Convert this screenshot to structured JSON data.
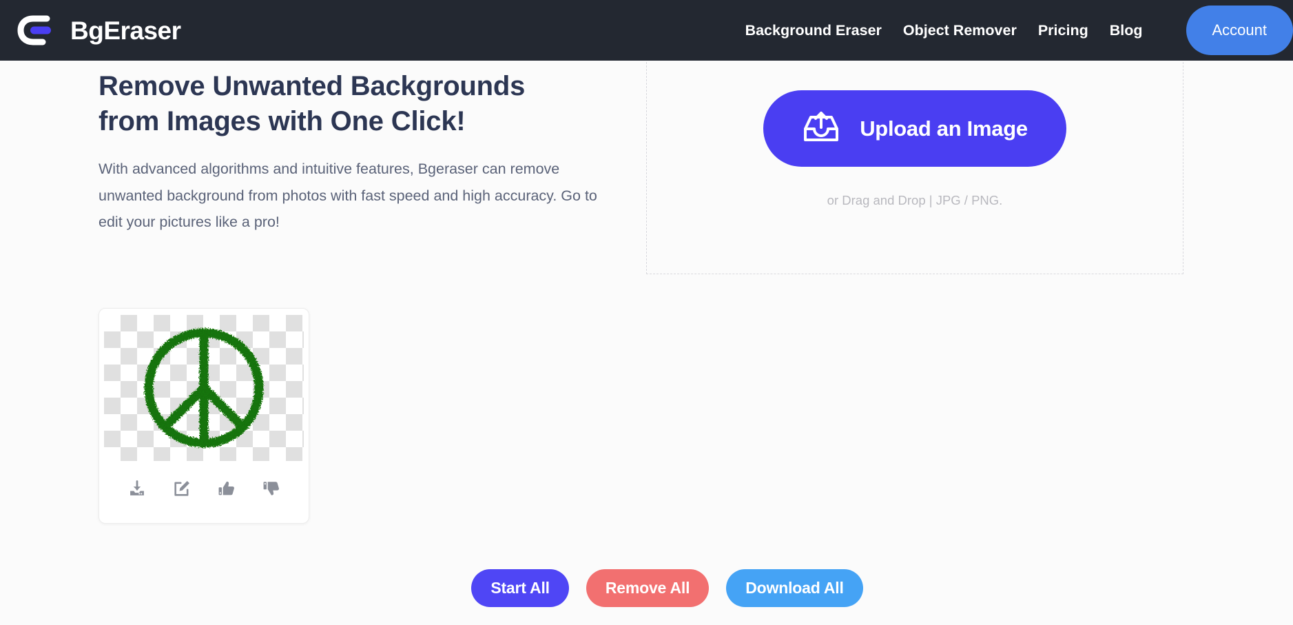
{
  "header": {
    "brand_name": "BgEraser",
    "brand_logo_icon": "bgeraser-logo-icon",
    "nav_links": [
      {
        "label": "Background Eraser",
        "name": "nav-background-eraser"
      },
      {
        "label": "Object Remover",
        "name": "nav-object-remover"
      },
      {
        "label": "Pricing",
        "name": "nav-pricing"
      },
      {
        "label": "Blog",
        "name": "nav-blog"
      }
    ],
    "account_label": "Account",
    "bar_color": "#232831",
    "account_color": "#4280e8"
  },
  "hero": {
    "title_line1": "Remove Unwanted Backgrounds",
    "title_line2": "from Images with One Click!",
    "description": "With advanced algorithms and intuitive features, Bgeraser can remove unwanted background from photos with fast speed and high accuracy. Go to edit your pictures like a pro!",
    "title_color": "#2c3653",
    "description_color": "#5a6278"
  },
  "dropzone": {
    "upload_label": "Upload an Image",
    "upload_icon": "upload-inbox-icon",
    "hint": "or Drag and Drop | JPG / PNG.",
    "upload_button_color": "#4a3ef2",
    "hint_color": "#b8b8be"
  },
  "result_card": {
    "image_alt": "green peace sign on transparent background",
    "actions": [
      {
        "label": "Download",
        "icon": "download-icon",
        "name": "download-result-icon"
      },
      {
        "label": "Edit",
        "icon": "edit-pencil-icon",
        "name": "edit-result-icon"
      },
      {
        "label": "Like",
        "icon": "thumbs-up-icon",
        "name": "like-result-icon"
      },
      {
        "label": "Dislike",
        "icon": "thumbs-down-icon",
        "name": "dislike-result-icon"
      }
    ],
    "icon_color": "#8b8f99"
  },
  "bottom_actions": [
    {
      "label": "Start All",
      "color": "#4f46f5",
      "name": "start-all-button"
    },
    {
      "label": "Remove All",
      "color": "#f27070",
      "name": "remove-all-button"
    },
    {
      "label": "Download All",
      "color": "#45a3f5",
      "name": "download-all-button"
    }
  ]
}
